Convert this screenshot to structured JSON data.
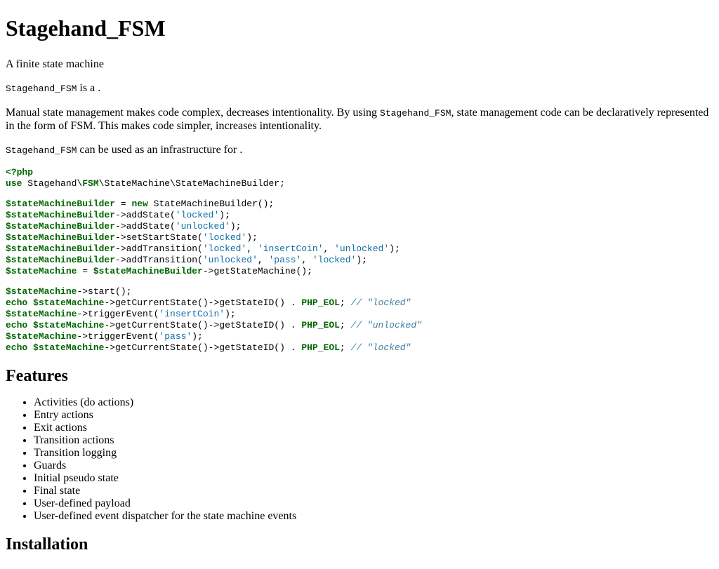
{
  "title": "Stagehand_FSM",
  "intro": "A finite state machine",
  "desc": {
    "code": "Stagehand_FSM",
    "text": " is a ."
  },
  "manual": {
    "part1": "Manual state management makes code complex, decreases intentionality. By using ",
    "code": "Stagehand_FSM",
    "part2": ", state management code can be declaratively represented in the form of FSM. This makes code simpler, increases intentionality."
  },
  "infra": {
    "code": "Stagehand_FSM",
    "text": " can be used as an infrastructure for ."
  },
  "code_lines": {
    "l1_tag": "<?php",
    "l2_use": "use",
    "l2_ns1": " Stagehand\\",
    "l2_ns2": "FSM",
    "l2_ns3": "\\StateMachine\\StateMachineBuilder;",
    "builder": "$stateMachineBuilder",
    "machine": "$stateMachine",
    "new_kw": "new",
    "echo_kw": "echo",
    "eol": "PHP_EOL",
    "s_locked": "'locked'",
    "s_unlocked": "'unlocked'",
    "s_insertCoin": "'insertCoin'",
    "s_pass": "'pass'",
    "c_locked": "// \"locked\"",
    "c_unlocked": "// \"unlocked\""
  },
  "features_heading": "Features",
  "features": [
    "Activities (do actions)",
    "Entry actions",
    "Exit actions",
    "Transition actions",
    "Transition logging",
    "Guards",
    "Initial pseudo state",
    "Final state",
    "User-defined payload",
    "User-defined event dispatcher for the state machine events"
  ],
  "install_heading": "Installation"
}
